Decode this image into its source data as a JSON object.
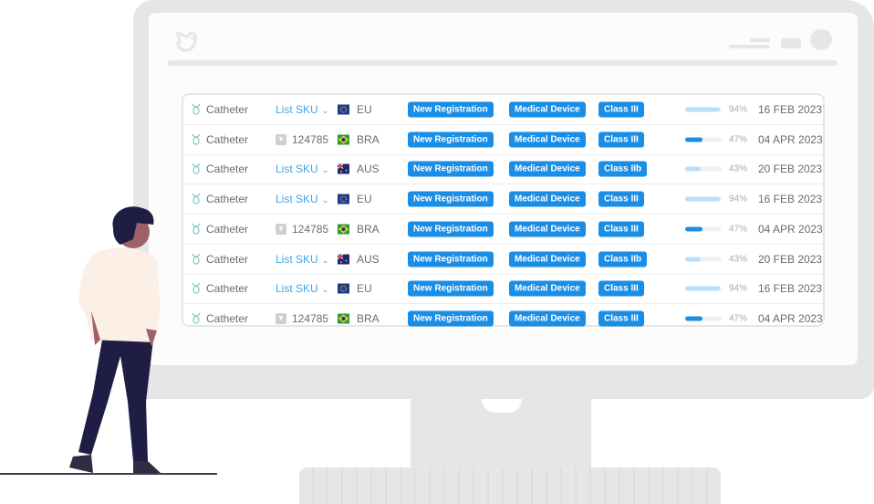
{
  "colors": {
    "accent": "#1a8ee6",
    "progress_light": "#b8def8",
    "progress_dark": "#1a8ee6",
    "link": "#3fa6e8"
  },
  "header": {
    "logo_icon": "bird-icon"
  },
  "table": {
    "rows": [
      {
        "product": "Catheter",
        "sku_type": "list",
        "sku": "List SKU",
        "flag": "eu",
        "country": "EU",
        "registration": "New Registration",
        "device": "Medical Device",
        "class": "Class III",
        "progress": 94,
        "progress_label": "94%",
        "date": "16 FEB 2023"
      },
      {
        "product": "Catheter",
        "sku_type": "code",
        "sku": "124785",
        "flag": "bra",
        "country": "BRA",
        "registration": "New Registration",
        "device": "Medical Device",
        "class": "Class III",
        "progress": 47,
        "progress_label": "47%",
        "date": "04 APR 2023"
      },
      {
        "product": "Catheter",
        "sku_type": "list",
        "sku": "List SKU",
        "flag": "aus",
        "country": "AUS",
        "registration": "New Registration",
        "device": "Medical Device",
        "class": "Class IIb",
        "progress": 43,
        "progress_label": "43%",
        "date": "20 FEB 2023"
      },
      {
        "product": "Catheter",
        "sku_type": "list",
        "sku": "List SKU",
        "flag": "eu",
        "country": "EU",
        "registration": "New Registration",
        "device": "Medical Device",
        "class": "Class III",
        "progress": 94,
        "progress_label": "94%",
        "date": "16 FEB 2023"
      },
      {
        "product": "Catheter",
        "sku_type": "code",
        "sku": "124785",
        "flag": "bra",
        "country": "BRA",
        "registration": "New Registration",
        "device": "Medical Device",
        "class": "Class III",
        "progress": 47,
        "progress_label": "47%",
        "date": "04 APR 2023"
      },
      {
        "product": "Catheter",
        "sku_type": "list",
        "sku": "List SKU",
        "flag": "aus",
        "country": "AUS",
        "registration": "New Registration",
        "device": "Medical Device",
        "class": "Class IIb",
        "progress": 43,
        "progress_label": "43%",
        "date": "20 FEB 2023"
      },
      {
        "product": "Catheter",
        "sku_type": "list",
        "sku": "List SKU",
        "flag": "eu",
        "country": "EU",
        "registration": "New Registration",
        "device": "Medical Device",
        "class": "Class III",
        "progress": 94,
        "progress_label": "94%",
        "date": "16 FEB 2023"
      },
      {
        "product": "Catheter",
        "sku_type": "code",
        "sku": "124785",
        "flag": "bra",
        "country": "BRA",
        "registration": "New Registration",
        "device": "Medical Device",
        "class": "Class III",
        "progress": 47,
        "progress_label": "47%",
        "date": "04 APR 2023"
      }
    ]
  }
}
